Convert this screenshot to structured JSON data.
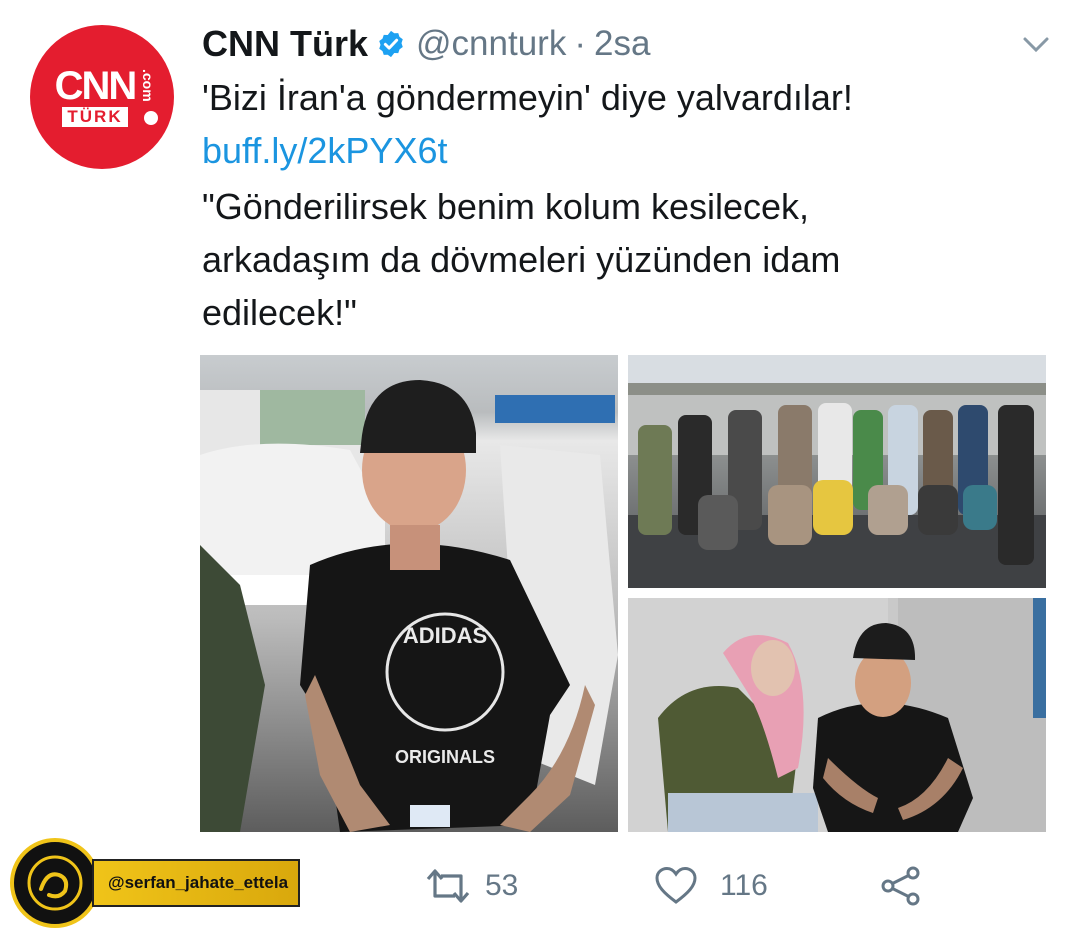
{
  "tweet": {
    "display_name": "CNN Türk",
    "handle": "@cnnturk",
    "separator": "·",
    "time": "2sa",
    "avatar": {
      "cnn": "CNN",
      "turk": "TÜRK",
      "com": ".com"
    },
    "lines": [
      "'Bizi İran'a göndermeyin' diye yalvardılar!",
      "buff.ly/2kPYX6t",
      "\"Gönderilirsek benim kolum kesilecek,",
      "arkadaşım da dövmeleri yüzünden idam",
      "edilecek!\""
    ],
    "photos": {
      "p1_shirt": "ADIDAS",
      "p1_sub": "ORIGINALS"
    },
    "actions": {
      "retweets": "53",
      "likes": "116"
    }
  },
  "watermark": {
    "handle": "@serfan_jahate_ettela"
  },
  "colors": {
    "accent": "#1b95e0",
    "brand": "#e41d2f",
    "muted": "#657786",
    "verified": "#1da1f2"
  },
  "icons": [
    "verified-badge-icon",
    "chevron-down-icon",
    "retweet-icon",
    "heart-icon",
    "share-icon"
  ]
}
